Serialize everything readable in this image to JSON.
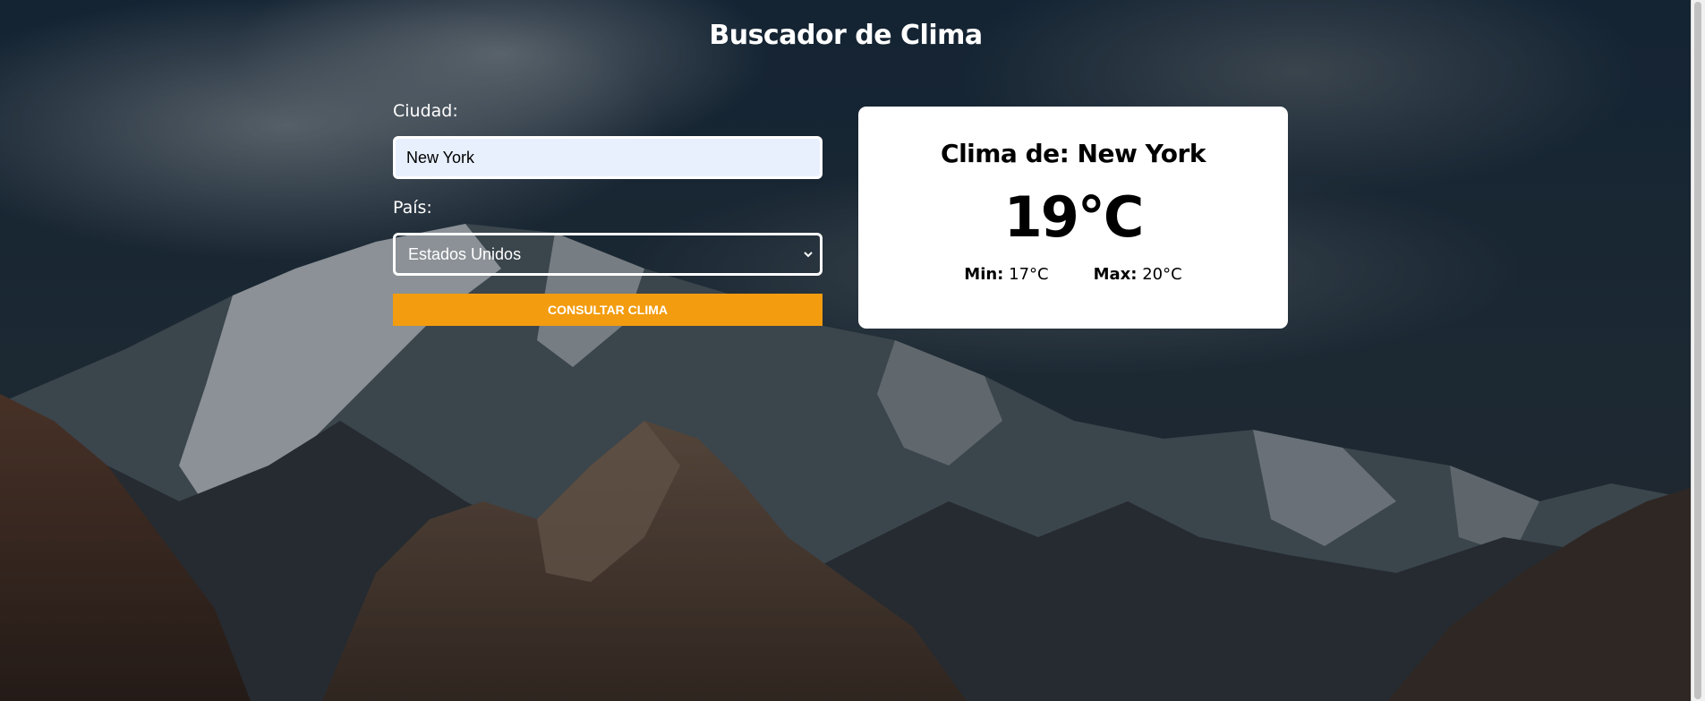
{
  "header": {
    "title": "Buscador de Clima"
  },
  "form": {
    "city_label": "Ciudad:",
    "city_value": "New York",
    "country_label": "País:",
    "country_selected": "Estados Unidos",
    "submit_label": "CONSULTAR CLIMA"
  },
  "result": {
    "title": "Clima de: New York",
    "temperature": "19°C",
    "min_label": "Min:",
    "min_value": "17°C",
    "max_label": "Max:",
    "max_value": "20°C"
  },
  "colors": {
    "accent": "#f39c0f",
    "input_background": "#e8f0fe",
    "card_background": "#ffffff"
  },
  "icons": {
    "select_arrow": "chevron-down-icon"
  }
}
